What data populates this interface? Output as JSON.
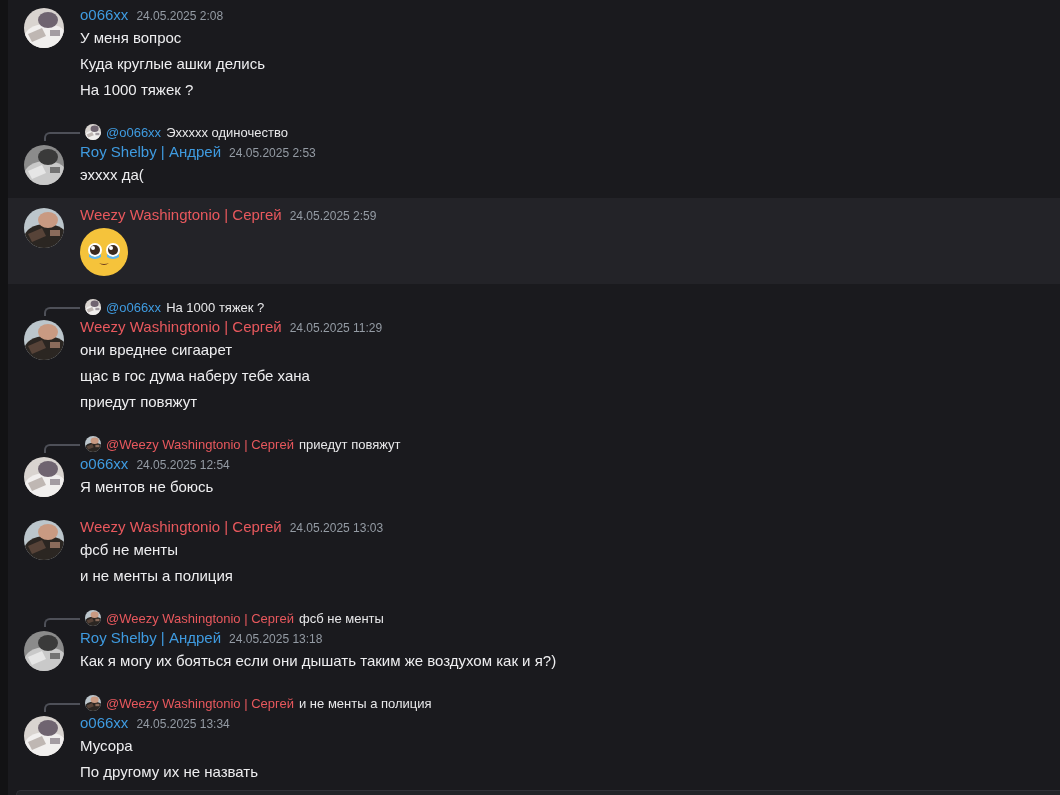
{
  "messages": [
    {
      "author": "o066xx",
      "color": "#3f9be0",
      "time": "24.05.2025 2:08",
      "highlighted": false,
      "lines": [
        {
          "kind": "text",
          "text": "У меня вопрос"
        },
        {
          "kind": "text",
          "text": "Куда круглые ашки делись"
        },
        {
          "kind": "text",
          "text": "На 1000 тяжек ?"
        }
      ]
    },
    {
      "reply": {
        "mention": "@o066xx",
        "color": "#3f9be0",
        "text": "Эххххх одиночество"
      },
      "author": "Roy Shelby | Андрей",
      "color": "#3f9be0",
      "time": "24.05.2025 2:53",
      "highlighted": false,
      "lines": [
        {
          "kind": "text",
          "text": "эхххх да("
        }
      ]
    },
    {
      "author": "Weezy Washingtonio | Сергей",
      "color": "#e8585d",
      "time": "24.05.2025 2:59",
      "highlighted": true,
      "lines": [
        {
          "kind": "emoji"
        }
      ]
    },
    {
      "reply": {
        "mention": "@o066xx",
        "color": "#3f9be0",
        "text": "На 1000 тяжек ?"
      },
      "author": "Weezy Washingtonio | Сергей",
      "color": "#e8585d",
      "time": "24.05.2025 11:29",
      "highlighted": false,
      "lines": [
        {
          "kind": "text",
          "text": "они вреднее сигаарет"
        },
        {
          "kind": "text",
          "text": "щас в гос дума наберу тебе хана"
        },
        {
          "kind": "text",
          "text": "приедут повяжут"
        }
      ]
    },
    {
      "reply": {
        "mention": "@Weezy Washingtonio | Сергей",
        "color": "#e8585d",
        "text": "приедут повяжут"
      },
      "author": "o066xx",
      "color": "#3f9be0",
      "time": "24.05.2025 12:54",
      "highlighted": false,
      "lines": [
        {
          "kind": "text",
          "text": "Я ментов не боюсь"
        }
      ]
    },
    {
      "author": "Weezy Washingtonio | Сергей",
      "color": "#e8585d",
      "time": "24.05.2025 13:03",
      "highlighted": false,
      "lines": [
        {
          "kind": "text",
          "text": "фсб не менты"
        },
        {
          "kind": "text",
          "text": "и не менты а полиция"
        }
      ]
    },
    {
      "reply": {
        "mention": "@Weezy Washingtonio | Сергей",
        "color": "#e8585d",
        "text": "фсб не менты"
      },
      "author": "Roy Shelby | Андрей",
      "color": "#3f9be0",
      "time": "24.05.2025 13:18",
      "highlighted": false,
      "lines": [
        {
          "kind": "text",
          "text": "Как я могу их бояться если они дышать таким же воздухом как и я?)"
        }
      ]
    },
    {
      "reply": {
        "mention": "@Weezy Washingtonio | Сергей",
        "color": "#e8585d",
        "text": "и не менты а полиция"
      },
      "author": "o066xx",
      "color": "#3f9be0",
      "time": "24.05.2025 13:34",
      "highlighted": false,
      "lines": [
        {
          "kind": "text",
          "text": "Мусора"
        },
        {
          "kind": "text",
          "text": "По другому их не назвать"
        }
      ]
    }
  ]
}
